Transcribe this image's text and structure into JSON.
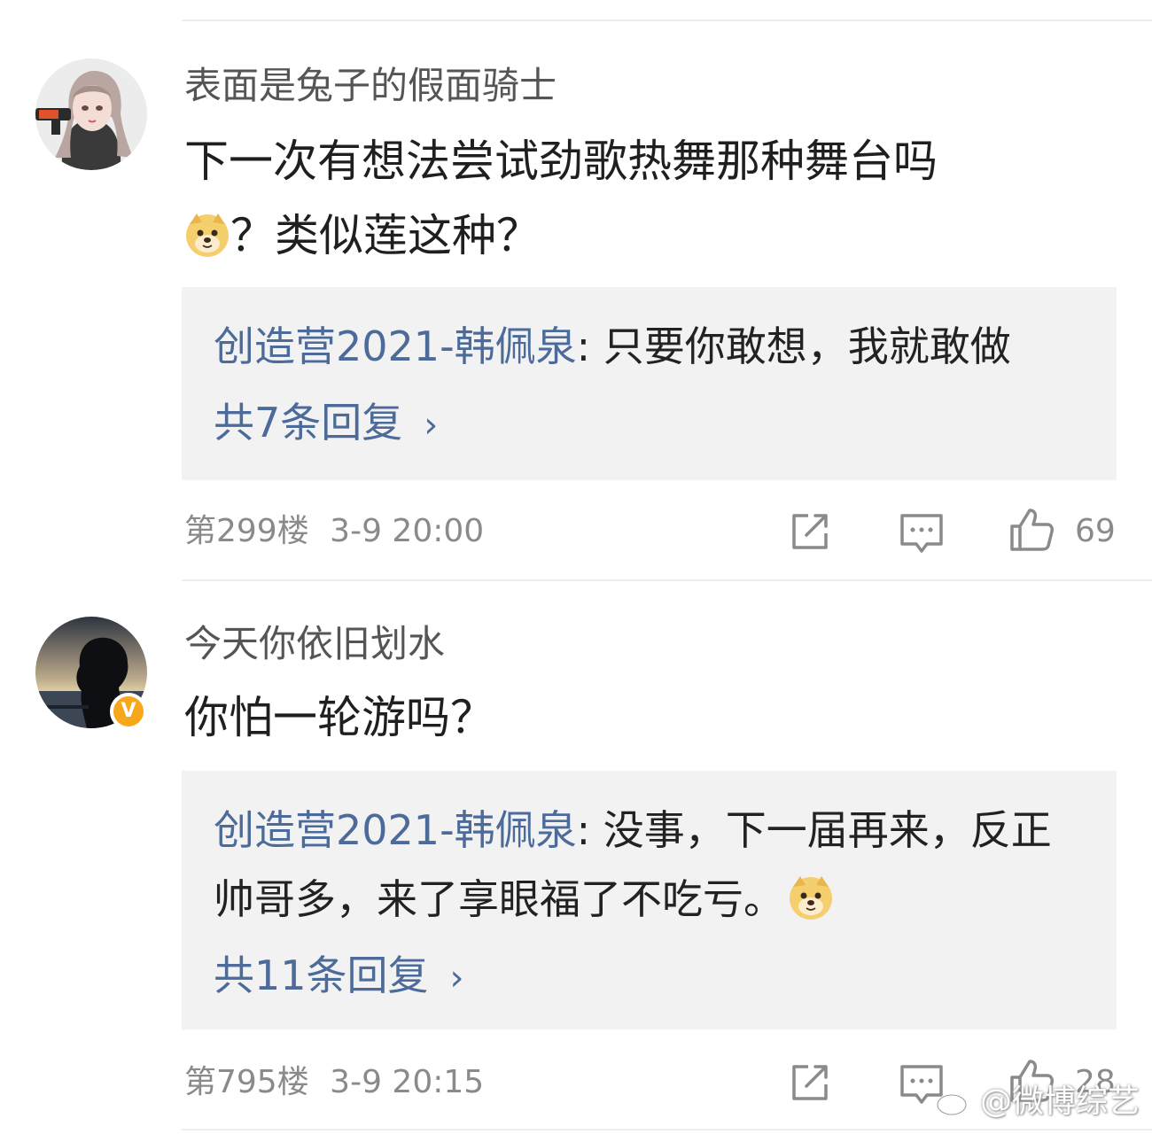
{
  "comments": [
    {
      "username": "表面是兔子的假面骑士",
      "text_line1": "下一次有想法尝试劲歌热舞那种舞台吗",
      "text_line2": "？类似莲这种？",
      "reply_author": "创造营2021-韩佩泉",
      "reply_separator": ": ",
      "reply_text": "只要你敢想，我就敢做",
      "reply_count": "共7条回复",
      "chevron": "›",
      "floor": "第299楼",
      "time": "3-9 20:00",
      "likes": "69",
      "avatar_icon": "anime-girl-avatar-icon",
      "verified": false
    },
    {
      "username": "今天你依旧划水",
      "text_line1": "你怕一轮游吗？",
      "reply_author": "创造营2021-韩佩泉",
      "reply_separator": ": ",
      "reply_text": "没事，下一届再来，反正帅哥多，来了享眼福了不吃亏。",
      "reply_count": "共11条回复",
      "chevron": "›",
      "floor": "第795楼",
      "time": "3-9 20:15",
      "likes": "28",
      "avatar_icon": "sunset-silhouette-avatar-icon",
      "verified": true,
      "verified_badge": "V"
    }
  ],
  "watermark": {
    "text": "@微博综艺",
    "logo_icon": "weibo-logo-icon"
  },
  "colors": {
    "reply_author": "#4c6b9a",
    "reply_bg": "#f2f2f2",
    "meta_text": "#8a8a8a",
    "verified_badge": "#f6a71a"
  },
  "icons": [
    "repost-icon",
    "comment-icon",
    "like-thumb-icon",
    "doge-emoji-icon"
  ]
}
